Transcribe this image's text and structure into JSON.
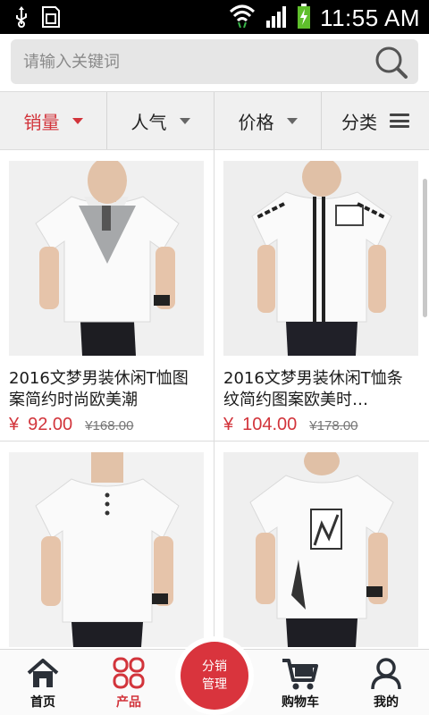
{
  "status_bar": {
    "time": "11:55 AM"
  },
  "search": {
    "placeholder": "请输入关键词"
  },
  "filters": [
    {
      "label": "销量",
      "active": true
    },
    {
      "label": "人气"
    },
    {
      "label": "价格"
    },
    {
      "label": "分类"
    }
  ],
  "products": [
    {
      "title": "2016文梦男装休闲T恤图案简约时尚欧美潮",
      "currency": "¥",
      "price": "92.00",
      "original_price": "¥168.00"
    },
    {
      "title": "2016文梦男装休闲T恤条纹简约图案欧美时…",
      "currency": "¥",
      "price": "104.00",
      "original_price": "¥178.00"
    },
    {
      "title": "",
      "currency": "",
      "price": "",
      "original_price": ""
    },
    {
      "title": "",
      "currency": "",
      "price": "",
      "original_price": ""
    }
  ],
  "bottom_nav": {
    "home": "首页",
    "products": "产品",
    "distribution_line1": "分销",
    "distribution_line2": "管理",
    "cart": "购物车",
    "mine": "我的"
  },
  "colors": {
    "accent": "#d2343b",
    "search_bg": "#e6e6e6",
    "filter_bg": "#f0f0f0"
  }
}
